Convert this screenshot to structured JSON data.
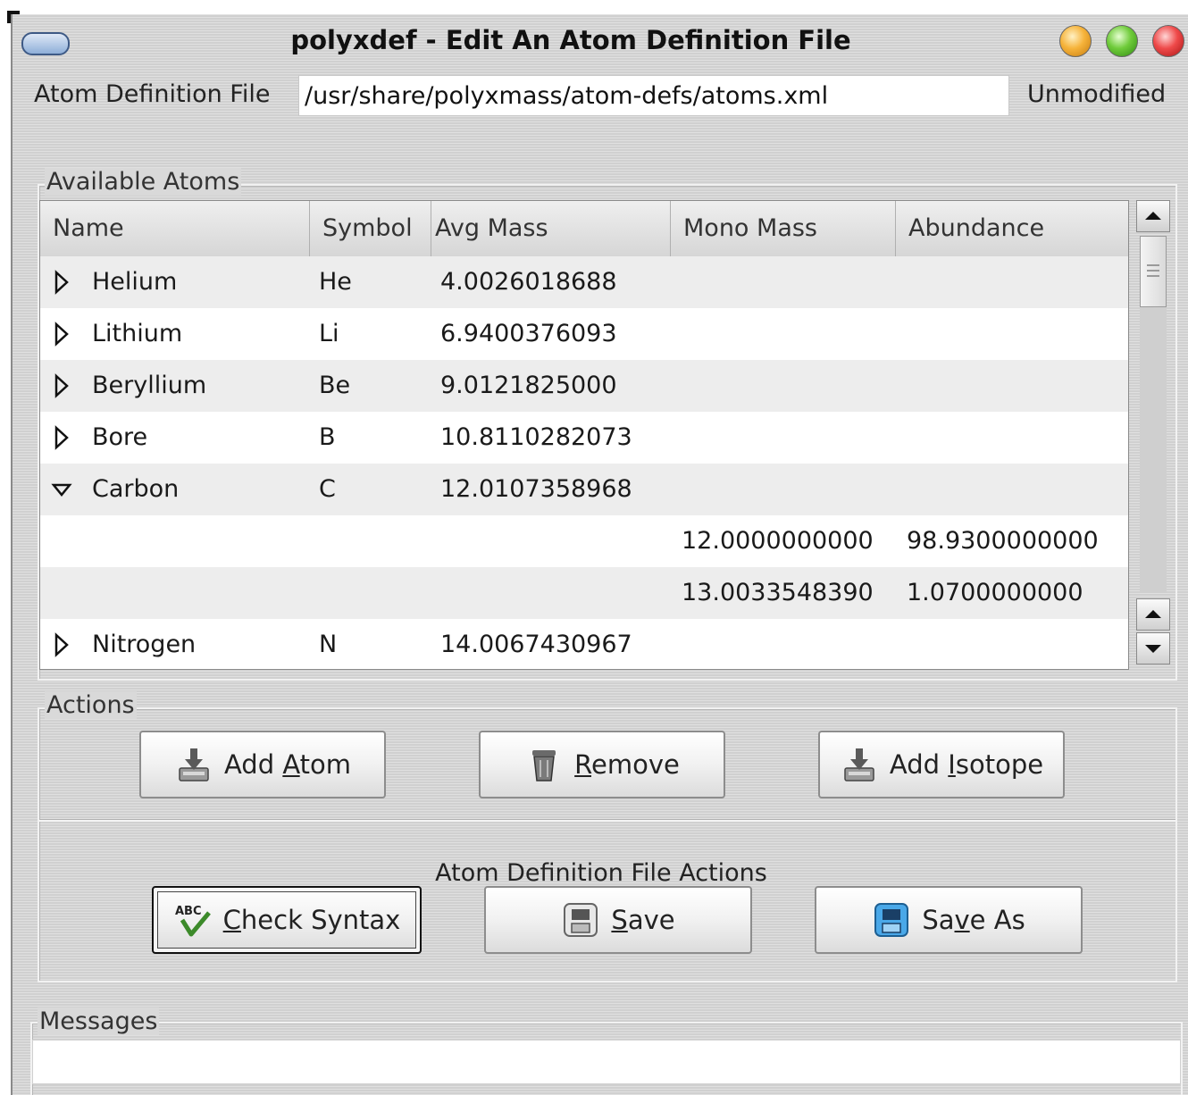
{
  "window": {
    "title": "polyxdef - Edit An Atom Definition File"
  },
  "file": {
    "label": "Atom Definition File",
    "path": "/usr/share/polyxmass/atom-defs/atoms.xml",
    "status": "Unmodified"
  },
  "atoms": {
    "group_title": "Available Atoms",
    "columns": [
      "Name",
      "Symbol",
      "Avg Mass",
      "Mono Mass",
      "Abundance"
    ],
    "rows": [
      {
        "name": "Helium",
        "symbol": "He",
        "avg": "4.0026018688",
        "mono": "",
        "abundance": "",
        "expander": "collapsed"
      },
      {
        "name": "Lithium",
        "symbol": "Li",
        "avg": "6.9400376093",
        "mono": "",
        "abundance": "",
        "expander": "collapsed"
      },
      {
        "name": "Beryllium",
        "symbol": "Be",
        "avg": "9.0121825000",
        "mono": "",
        "abundance": "",
        "expander": "collapsed"
      },
      {
        "name": "Bore",
        "symbol": "B",
        "avg": "10.8110282073",
        "mono": "",
        "abundance": "",
        "expander": "collapsed"
      },
      {
        "name": "Carbon",
        "symbol": "C",
        "avg": "12.0107358968",
        "mono": "",
        "abundance": "",
        "expander": "expanded"
      },
      {
        "name": "",
        "symbol": "",
        "avg": "",
        "mono": "12.0000000000",
        "abundance": "98.9300000000",
        "expander": "none"
      },
      {
        "name": "",
        "symbol": "",
        "avg": "",
        "mono": "13.0033548390",
        "abundance": "1.0700000000",
        "expander": "none"
      },
      {
        "name": "Nitrogen",
        "symbol": "N",
        "avg": "14.0067430967",
        "mono": "",
        "abundance": "",
        "expander": "collapsed"
      }
    ]
  },
  "actions": {
    "group_title": "Actions",
    "add_atom": {
      "pre": "Add ",
      "key": "A",
      "post": "tom",
      "icon": "tray-download-icon"
    },
    "remove": {
      "pre": "",
      "key": "R",
      "post": "emove",
      "icon": "trash-can-icon"
    },
    "add_isotope": {
      "pre": "Add ",
      "key": "I",
      "post": "sotope",
      "icon": "tray-download-icon"
    },
    "file_actions_title": "Atom Definition File Actions",
    "check_syntax": {
      "pre": "",
      "key": "C",
      "post": "heck Syntax",
      "icon": "spell-check-icon"
    },
    "save": {
      "pre": "",
      "key": "S",
      "post": "ave",
      "icon": "floppy-disk-icon"
    },
    "save_as": {
      "pre": "Sa",
      "key": "v",
      "post": "e As",
      "icon": "floppy-disk-blue-icon"
    }
  },
  "messages": {
    "group_title": "Messages"
  },
  "colors": {
    "row_even": "#ededed",
    "row_odd": "#ffffff",
    "window_bg": "#d9d9d9"
  }
}
